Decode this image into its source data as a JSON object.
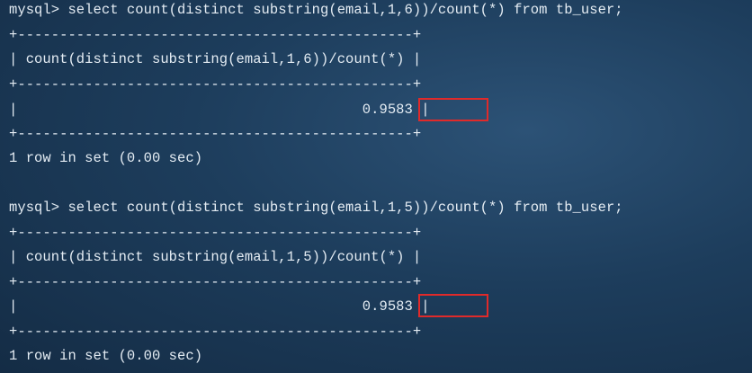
{
  "terminal": {
    "blocks": [
      {
        "command_line": "mysql> select count(distinct substring(email,1,6))/count(*) from tb_user;",
        "border_top": "+-----------------------------------------------+",
        "header_row": "| count(distinct substring(email,1,6))/count(*) |",
        "border_mid": "+-----------------------------------------------+",
        "value_row": "|                                         0.9583 |",
        "border_bottom": "+-----------------------------------------------+",
        "result_info": "1 row in set (0.00 sec)",
        "highlighted_value": "0.9583"
      },
      {
        "command_line": "mysql> select count(distinct substring(email,1,5))/count(*) from tb_user;",
        "border_top": "+-----------------------------------------------+",
        "header_row": "| count(distinct substring(email,1,5))/count(*) |",
        "border_mid": "+-----------------------------------------------+",
        "value_row": "|                                         0.9583 |",
        "border_bottom": "+-----------------------------------------------+",
        "result_info": "1 row in set (0.00 sec)",
        "highlighted_value": "0.9583"
      }
    ],
    "colors": {
      "background": "#1d3d5c",
      "text": "#e4ecf3",
      "highlight_box": "#e02a2a"
    }
  }
}
